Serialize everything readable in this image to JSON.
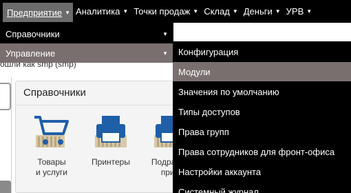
{
  "topbar": {
    "items": [
      {
        "label": "Предприятие"
      },
      {
        "label": "Аналитика"
      },
      {
        "label": "Точки продаж"
      },
      {
        "label": "Склад"
      },
      {
        "label": "Деньги"
      },
      {
        "label": "УРВ"
      }
    ]
  },
  "page": {
    "signed_in_text": "ошли как smp (smp)",
    "panel_title": "Справочники",
    "tiles": [
      {
        "label": "Товары\nи услуги",
        "icon": "cart-icon"
      },
      {
        "label": "Принтеры",
        "icon": "printer-icon"
      },
      {
        "label": "Подразде\nприн",
        "icon": "printer-icon"
      }
    ]
  },
  "menu_level1": {
    "items": [
      {
        "label": "Справочники",
        "highlighted": false
      },
      {
        "label": "Управление",
        "highlighted": true
      }
    ]
  },
  "menu_level2": {
    "items": [
      {
        "label": "Конфигурация",
        "highlighted": false
      },
      {
        "label": "Модули",
        "highlighted": true
      },
      {
        "label": "Значения по умолчанию",
        "highlighted": false
      },
      {
        "label": "Типы доступов",
        "highlighted": false
      },
      {
        "label": "Права групп",
        "highlighted": false
      },
      {
        "label": "Права сотрудников для фронт-офиса",
        "highlighted": false
      },
      {
        "label": "Настройки аккаунта",
        "highlighted": false
      },
      {
        "label": "Системный журнал",
        "highlighted": false
      }
    ]
  },
  "colors": {
    "menu_bg": "#000000",
    "menu_text": "#ffffff",
    "highlight": "#7a6f6f",
    "icon_blue": "#1f5fa8"
  }
}
